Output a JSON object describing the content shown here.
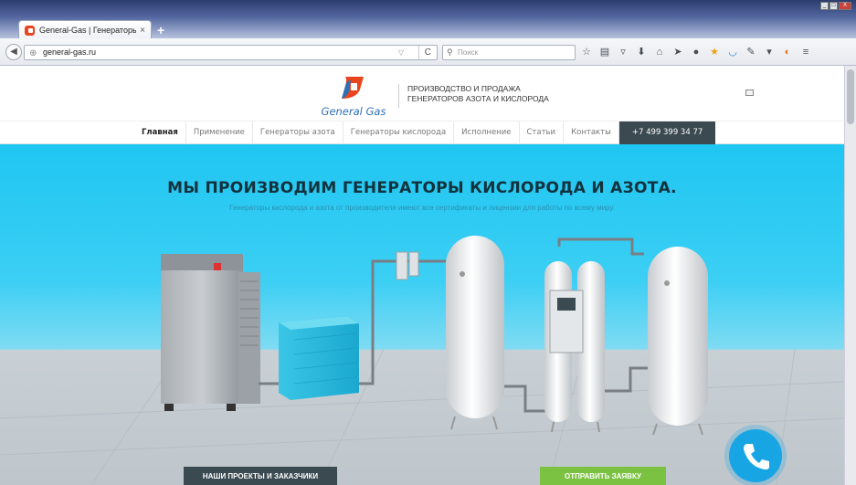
{
  "browser": {
    "tab_title": "General-Gas | Генераторы к...",
    "tab_close": "×",
    "new_tab": "+",
    "url": "general-gas.ru",
    "search_placeholder": "Поиск",
    "window_controls": [
      "_",
      "□",
      "X"
    ]
  },
  "header": {
    "brand": "General Gas",
    "tagline_line1": "ПРОИЗВОДСТВО И ПРОДАЖА",
    "tagline_line2": "ГЕНЕРАТОРОВ АЗОТА И КИСЛОРОДА"
  },
  "nav": {
    "items": [
      "Главная",
      "Применение",
      "Генераторы азота",
      "Генераторы кислорода",
      "Исполнение",
      "Статьи",
      "Контакты"
    ],
    "phone": "+7 499 399 34 77"
  },
  "hero": {
    "title": "МЫ ПРОИЗВОДИМ ГЕНЕРАТОРЫ КИСЛОРОДА И АЗОТА.",
    "subtitle": "Генераторы кислорода и азота от производителя имеют все сертификаты и лицензии для работы по всему миру.",
    "button1": "НАШИ ПРОЕКТЫ И ЗАКАЗЧИКИ",
    "button2": "ОТПРАВИТЬ ЗАЯВКУ"
  },
  "colors": {
    "accent": "#18a5e4",
    "nav_phone_bg": "#3a4a50",
    "hero_sky": "#1fc6f2",
    "cta_green": "#7cc242",
    "logo_orange": "#e8451e",
    "logo_blue": "#2d6fb3"
  }
}
